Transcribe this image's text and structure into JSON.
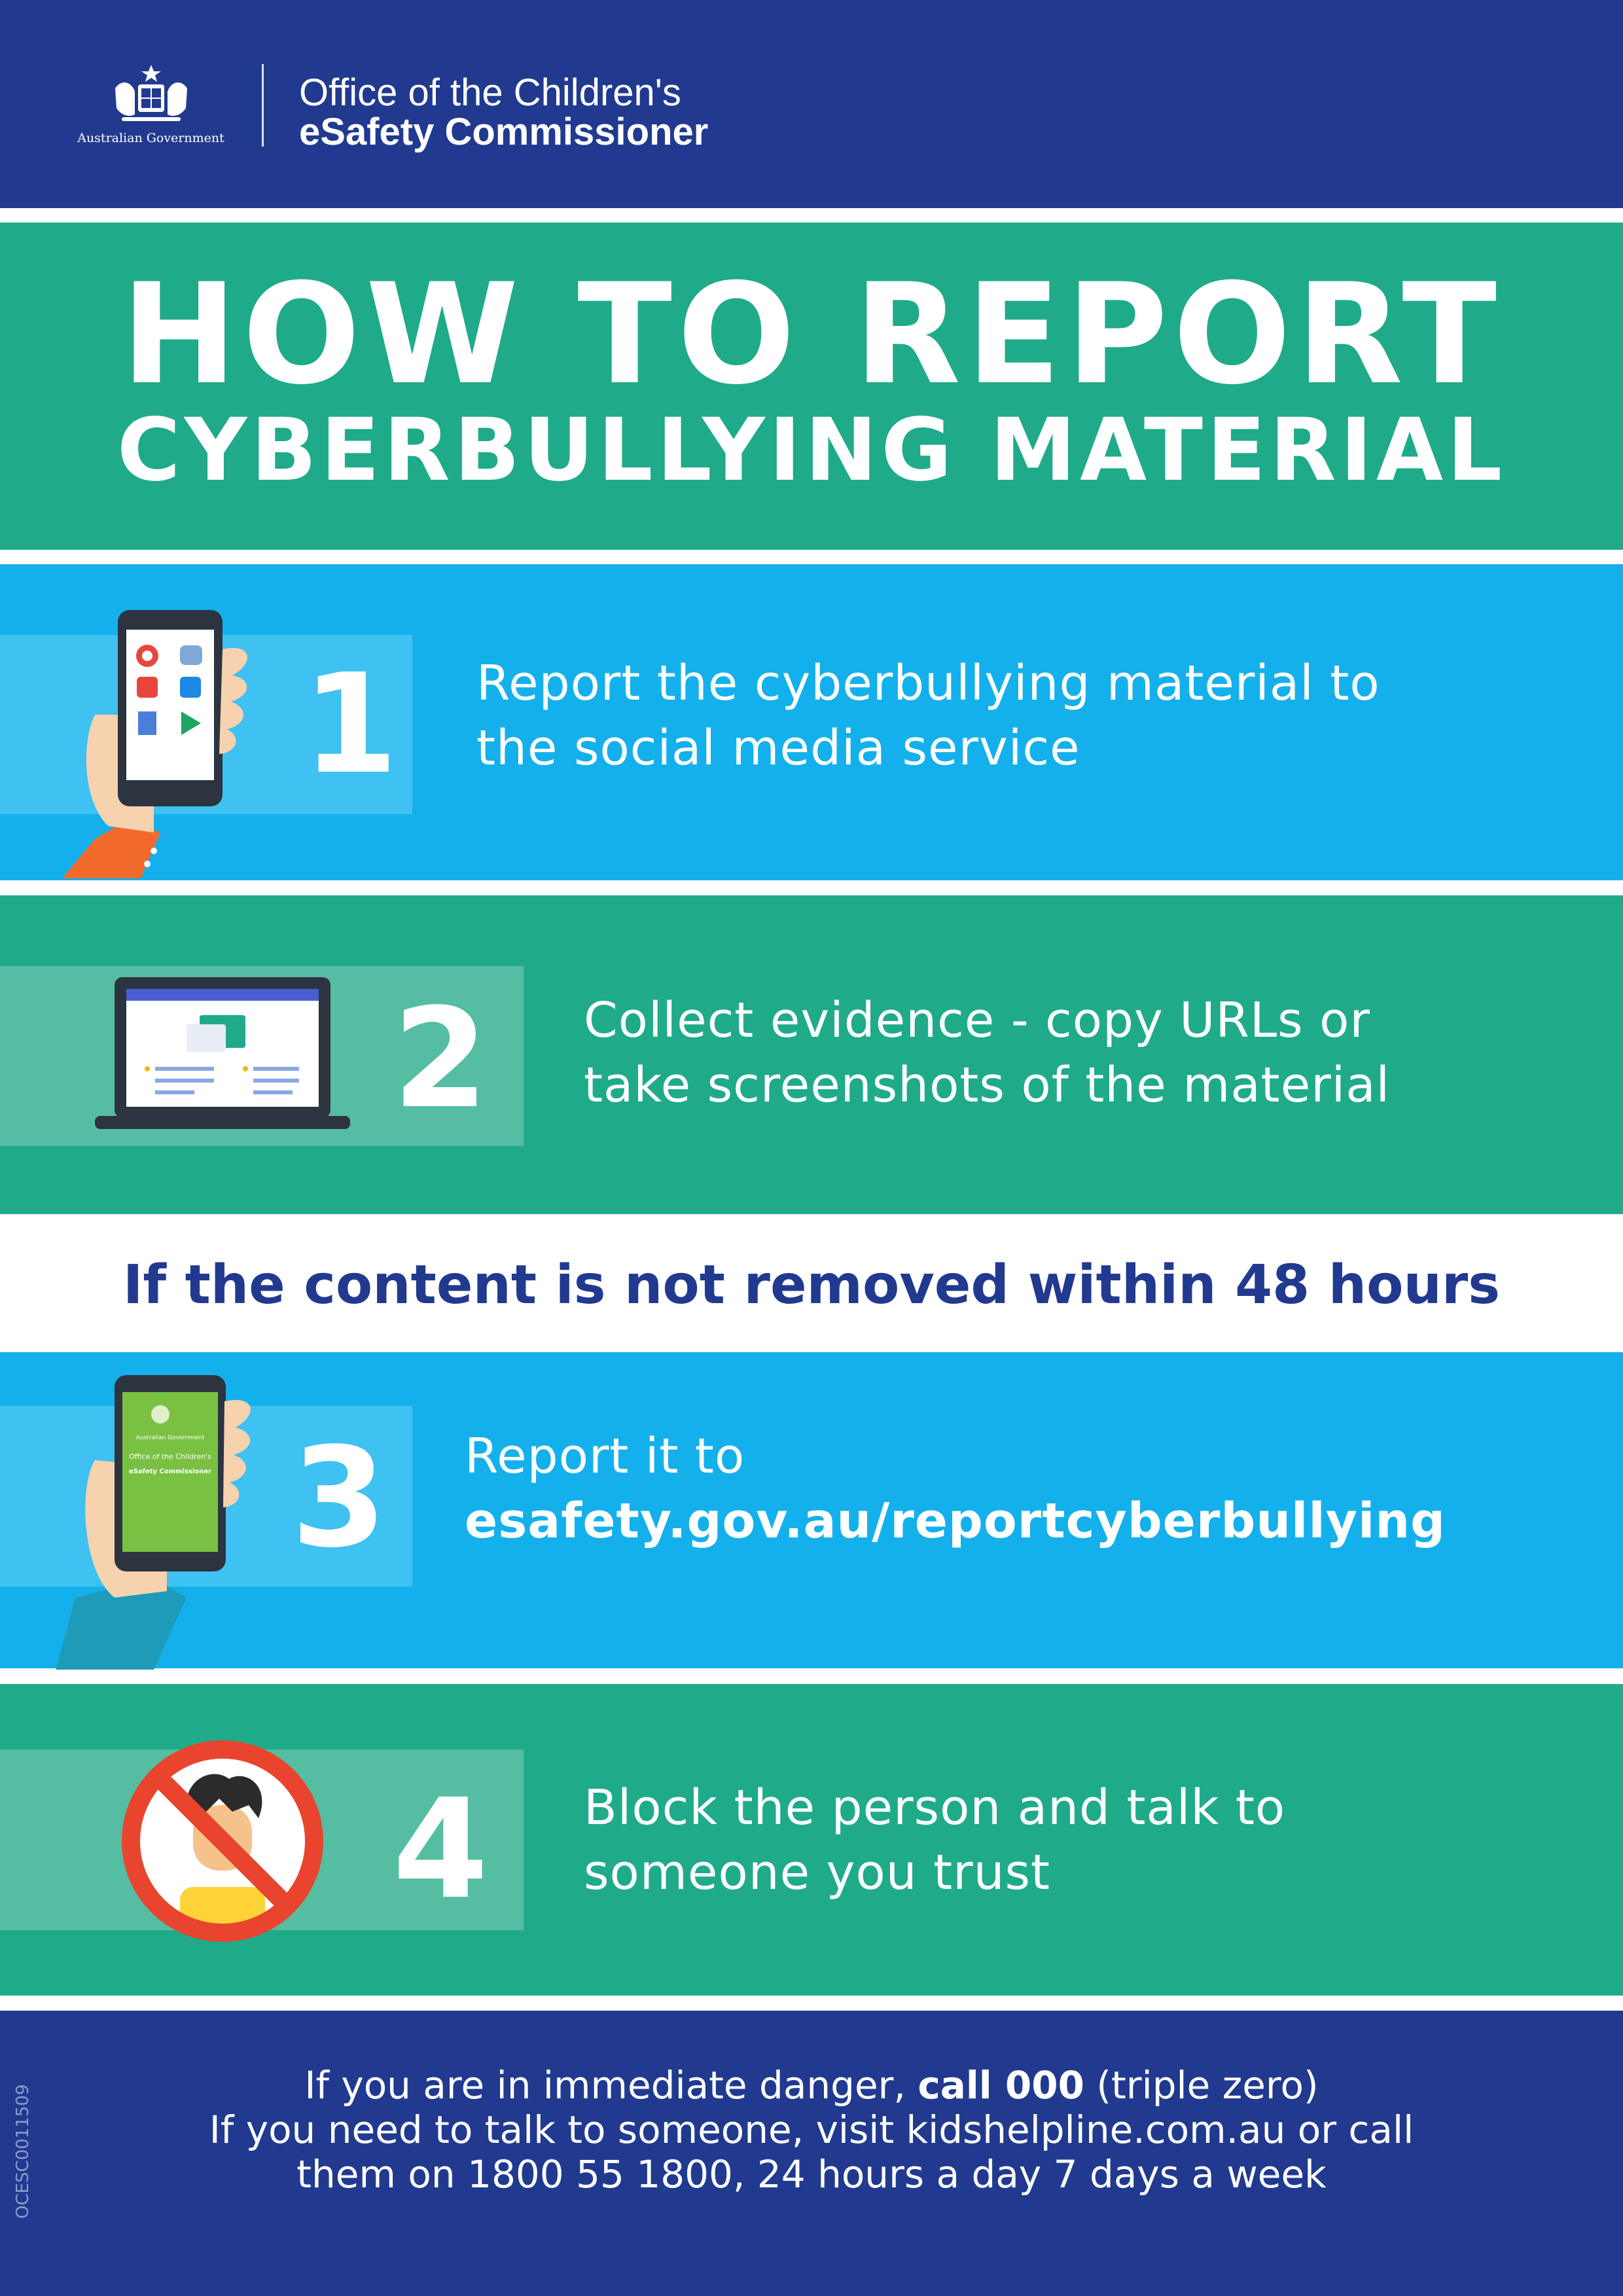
{
  "header": {
    "crest_caption": "Australian Government",
    "office_line1": "Office of the Children's",
    "office_line2": "eSafety Commissioner"
  },
  "title": {
    "line1": "HOW TO REPORT",
    "line2": "CYBERBULLYING MATERIAL"
  },
  "steps": [
    {
      "number": "1",
      "line1": "Report the cyberbullying material to",
      "line2": "the social media service",
      "icon": "phone-in-hand-icon"
    },
    {
      "number": "2",
      "line1": "Collect evidence - copy URLs or",
      "line2": "take screenshots of the material",
      "icon": "laptop-icon"
    },
    {
      "number": "3",
      "line1": "Report it to",
      "line2": "esafety.gov.au/reportcyberbullying",
      "icon": "esafety-phone-icon",
      "phone_caption_top": "Australian Government",
      "phone_caption_mid": "Office of the Children's",
      "phone_caption_brand": "eSafety Commissioner"
    },
    {
      "number": "4",
      "line1": "Block the person and talk to",
      "line2": "someone you trust",
      "icon": "blocked-person-icon"
    }
  ],
  "condition": "If the content is not removed within 48 hours",
  "footer": {
    "line1_pre": "If you are in immediate danger, ",
    "line1_bold": "call 000",
    "line1_post": " (triple zero)",
    "line2": "If you need to talk to someone, visit kidshelpline.com.au or call",
    "line3": "them on 1800 55 1800, 24 hours a day 7 days a week",
    "doc_code": "OCESC0011509"
  },
  "colors": {
    "navy": "#213a8f",
    "teal": "#1fab8a",
    "blue": "#14b0ec",
    "white": "#ffffff"
  }
}
